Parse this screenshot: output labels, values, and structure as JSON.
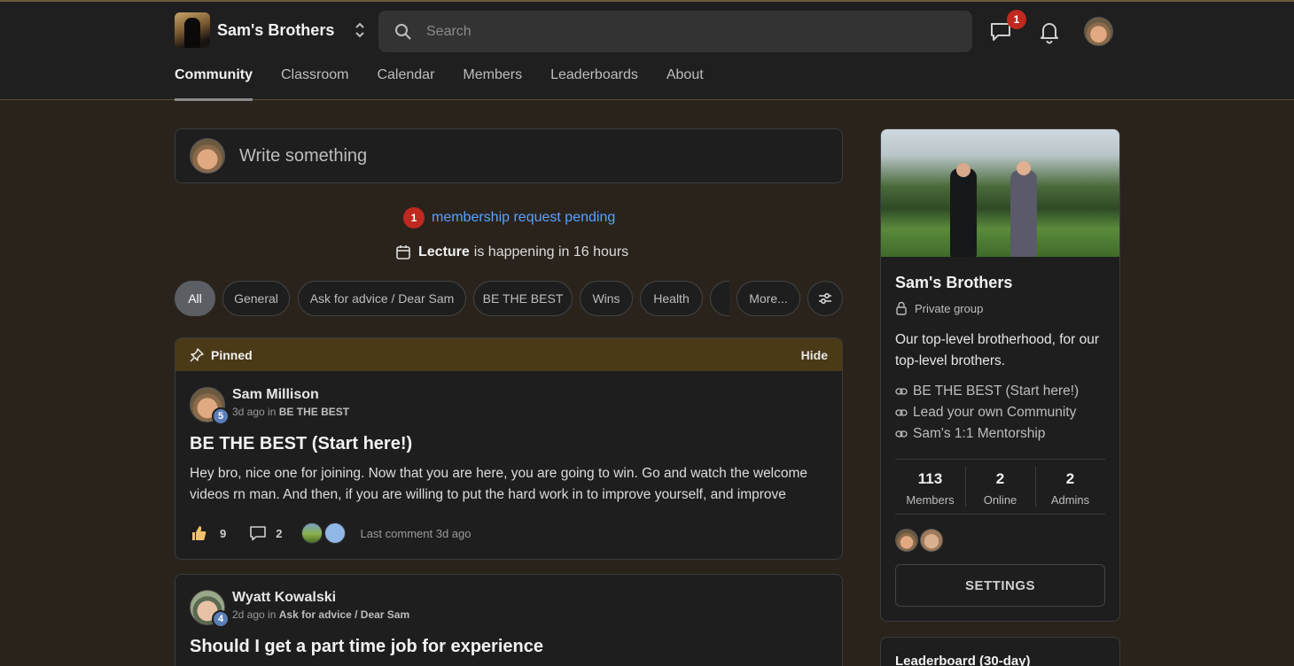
{
  "brand": {
    "name": "Sam's Brothers"
  },
  "search": {
    "placeholder": "Search"
  },
  "header": {
    "chat_badge": "1"
  },
  "nav": [
    "Community",
    "Classroom",
    "Calendar",
    "Members",
    "Leaderboards",
    "About"
  ],
  "composer": {
    "placeholder": "Write something"
  },
  "pending": {
    "count": "1",
    "text": "membership request pending"
  },
  "event": {
    "name": "Lecture",
    "text": "is happening in 16 hours"
  },
  "categories": [
    "All",
    "General",
    "Ask for advice / Dear Sam",
    "BE THE BEST",
    "Wins",
    "Health",
    "More..."
  ],
  "pinned": {
    "label": "Pinned",
    "hide": "Hide"
  },
  "posts": [
    {
      "author": "Sam Millison",
      "level": "5",
      "meta": "3d ago in",
      "category": "BE THE BEST",
      "title": "BE THE BEST (Start here!)",
      "body": "Hey bro, nice one for joining. Now that you are here, you are going to win. Go and watch the welcome videos rn man. And then, if you are willing to put the hard work in to improve yourself, and improve",
      "likes": "9",
      "comments": "2",
      "last_comment": "Last comment 3d ago"
    },
    {
      "author": "Wyatt Kowalski",
      "level": "4",
      "meta": "2d ago in",
      "category": "Ask for advice / Dear Sam",
      "title": "Should I get a part time job for experience"
    }
  ],
  "group": {
    "name": "Sam's Brothers",
    "privacy": "Private group",
    "description": "Our top-level brotherhood, for our top-level brothers.",
    "links": [
      "BE THE BEST (Start here!)",
      "Lead your own Community",
      "Sam's 1:1 Mentorship"
    ],
    "stats": [
      {
        "value": "113",
        "label": "Members"
      },
      {
        "value": "2",
        "label": "Online"
      },
      {
        "value": "2",
        "label": "Admins"
      }
    ],
    "settings": "SETTINGS"
  },
  "leaderboard": {
    "title": "Leaderboard (30-day)"
  },
  "colors": {
    "accent_link": "#5aa0ff",
    "badge": "#c0291f",
    "pinned_bar": "#4a3a18"
  }
}
